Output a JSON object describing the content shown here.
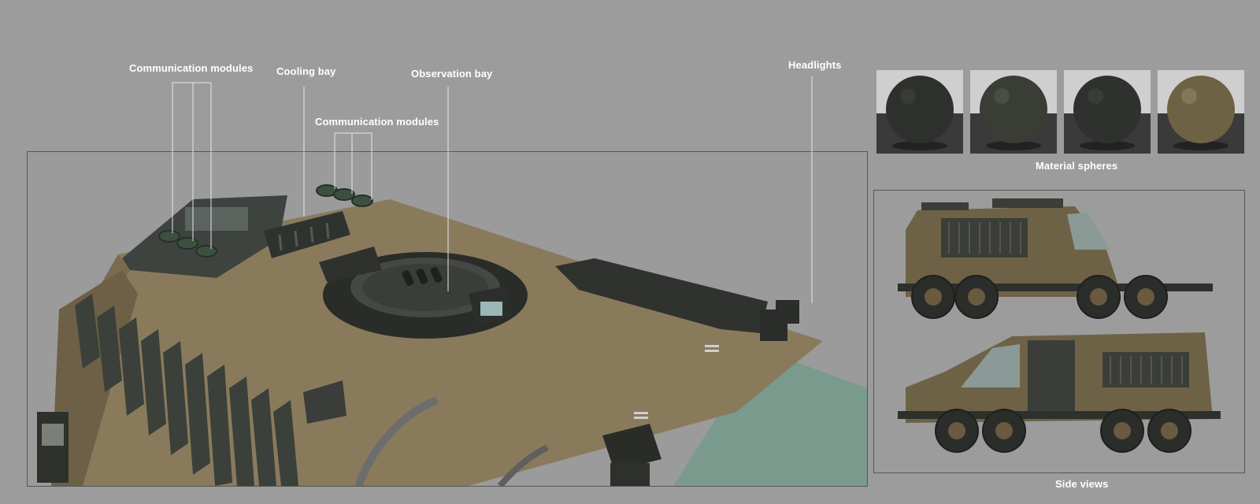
{
  "labels": {
    "communication_modules_left": "Communication modules",
    "cooling_bay": "Cooling bay",
    "observation_bay": "Observation bay",
    "communication_modules_right": "Communication modules",
    "headlights": "Headlights",
    "material_spheres": "Material spheres",
    "side_views": "Side views"
  },
  "colors": {
    "background": "#9c9c9c",
    "hull_tan": "#8a7a5e",
    "panel_dark": "#3a3e38",
    "glass_teal": "#7a9a8e",
    "label": "#ffffff"
  },
  "material_spheres": [
    {
      "name": "dark-rough-sphere",
      "color": "#2d302c"
    },
    {
      "name": "dark-smooth-sphere",
      "color": "#3a3c36"
    },
    {
      "name": "dark-worn-sphere",
      "color": "#2e312e"
    },
    {
      "name": "tan-sphere",
      "color": "#6e6244"
    }
  ]
}
